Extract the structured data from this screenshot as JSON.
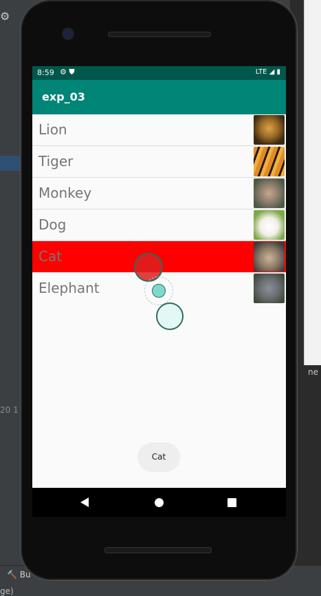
{
  "ide": {
    "bottom_button": "Bu",
    "bottom_text": "ge)",
    "left_text": "20 1",
    "right_tab": "ne"
  },
  "status": {
    "time": "8:59",
    "network": "LTE"
  },
  "app": {
    "title": "exp_03"
  },
  "list": {
    "items": [
      {
        "label": "Lion",
        "image": "lion-photo",
        "selected": false
      },
      {
        "label": "Tiger",
        "image": "tiger-photo",
        "selected": false
      },
      {
        "label": "Monkey",
        "image": "monkey-photo",
        "selected": false
      },
      {
        "label": "Dog",
        "image": "dog-photo",
        "selected": false
      },
      {
        "label": "Cat",
        "image": "cat-photo",
        "selected": true
      },
      {
        "label": "Elephant",
        "image": "elephant-photo",
        "selected": false
      }
    ],
    "selected_color": "#ff0000"
  },
  "toast": {
    "text": "Cat"
  },
  "colors": {
    "appbar": "#008577",
    "statusbar": "#00574b"
  }
}
